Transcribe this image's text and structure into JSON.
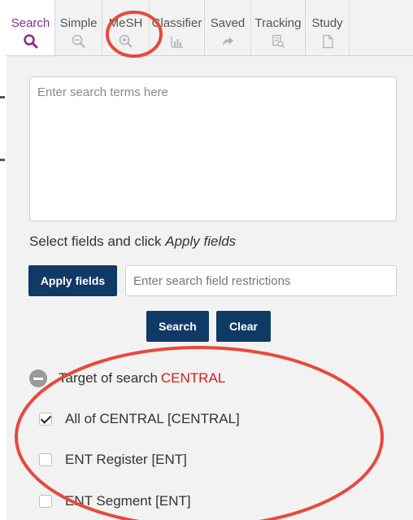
{
  "tabs": [
    {
      "label": "Search",
      "icon": "search-icon",
      "active": true
    },
    {
      "label": "Simple",
      "icon": "zoom-out-icon",
      "active": false
    },
    {
      "label": "MeSH",
      "icon": "zoom-in-icon",
      "active": false
    },
    {
      "label": "Classifier",
      "icon": "bar-chart-icon",
      "active": false
    },
    {
      "label": "Saved",
      "icon": "share-arrow-icon",
      "active": false
    },
    {
      "label": "Tracking",
      "icon": "document-search-icon",
      "active": false
    },
    {
      "label": "Study",
      "icon": "document-icon",
      "active": false
    }
  ],
  "search": {
    "placeholder": "Enter search terms here",
    "value": ""
  },
  "fields": {
    "instruction_prefix": "Select fields and click ",
    "instruction_emphasis": "Apply fields",
    "apply_label": "Apply fields",
    "input_placeholder": "Enter search field restrictions"
  },
  "actions": {
    "search_label": "Search",
    "clear_label": "Clear"
  },
  "target": {
    "label": "Target of search",
    "database": "CENTRAL"
  },
  "options": [
    {
      "label": "All of CENTRAL [CENTRAL]",
      "checked": true
    },
    {
      "label": "ENT Register [ENT]",
      "checked": false
    },
    {
      "label": "ENT Segment [ENT]",
      "checked": false
    }
  ],
  "colors": {
    "accent": "#8b2a8b",
    "button": "#103a66",
    "highlight_text": "#d81b1b",
    "annotation": "#e74a3c"
  }
}
